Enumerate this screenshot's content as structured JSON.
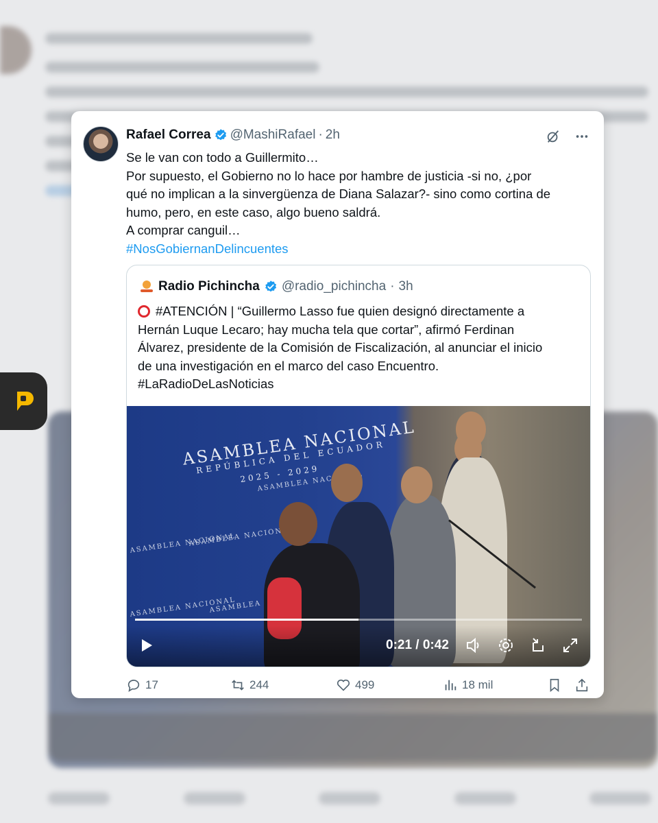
{
  "tweet": {
    "author_name": "Rafael Correa",
    "handle": "@MashiRafael",
    "separator": "·",
    "time": "2h",
    "lines": [
      "Se le van con todo a Guillermito…",
      "Por supuesto, el Gobierno no lo hace por hambre de justicia -si no, ¿por",
      "qué no implican a la sinvergüenza de Diana Salazar?- sino como cortina de",
      "humo, pero, en este caso, algo bueno saldrá.",
      "A comprar canguil…"
    ],
    "hashtag": "#NosGobiernanDelincuentes"
  },
  "quote": {
    "author_name": "Radio Pichincha",
    "handle": "@radio_pichincha",
    "separator": "·",
    "time": "3h",
    "lines": [
      "#ATENCIÓN | “Guillermo Lasso fue quien designó directamente a",
      "Hernán Luque Lecaro; hay mucha tela que cortar”, afirmó Ferdinan",
      "Álvarez, presidente de la Comisión de Fiscalización, al anunciar el inicio",
      "de una investigación en el marco del caso Encuentro.",
      "#LaRadioDeLasNoticias"
    ],
    "video": {
      "backdrop_title": "ASAMBLEA NACIONAL",
      "backdrop_subtitle": "REPÚBLICA DEL ECUADOR",
      "backdrop_years": "2025 - 2029",
      "time_display": "0:21 / 0:42",
      "progress": 0.5
    }
  },
  "actions": {
    "replies": "17",
    "reposts": "244",
    "likes": "499",
    "views": "18 mil"
  },
  "colors": {
    "accent": "#1d9bf0",
    "verified": "#1d9bf0",
    "attention_ring": "#e0282e",
    "badge_logo": "#f5b800"
  },
  "icons": [
    "verified-badge-icon",
    "grok-icon",
    "more-icon",
    "play-icon",
    "volume-icon",
    "settings-icon",
    "popout-icon",
    "fullscreen-icon",
    "reply-icon",
    "repost-icon",
    "like-icon",
    "views-icon",
    "bookmark-icon",
    "share-icon"
  ]
}
